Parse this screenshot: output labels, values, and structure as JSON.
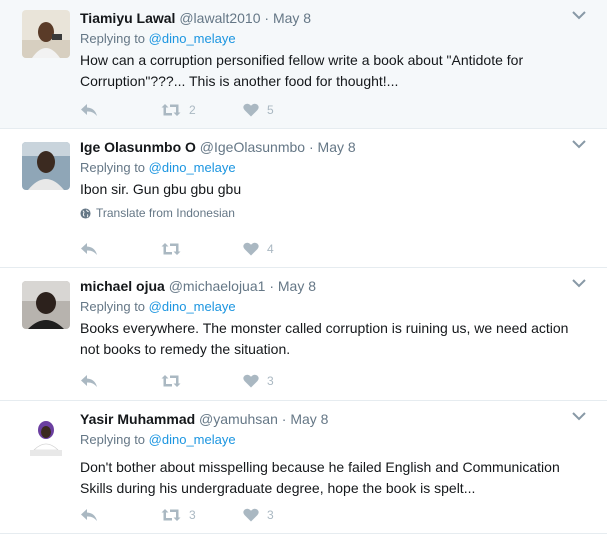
{
  "tweets": [
    {
      "name": "Tiamiyu Lawal",
      "handle": "@lawalt2010",
      "date": "May 8",
      "replying_prefix": "Replying to",
      "replying_to": "@dino_melaye",
      "text": "How can a corruption personified fellow write a book about \"Antidote for Corruption\"???... This is another food for thought!...",
      "translate": "",
      "retweets": "2",
      "likes": "5"
    },
    {
      "name": "Ige Olasunmbo O",
      "handle": "@IgeOlasunmbo",
      "date": "May 8",
      "replying_prefix": "Replying to",
      "replying_to": "@dino_melaye",
      "text": "Ibon sir.  Gun gbu gbu gbu",
      "translate": "Translate from Indonesian",
      "retweets": "",
      "likes": "4"
    },
    {
      "name": "michael ojua",
      "handle": "@michaelojua1",
      "date": "May 8",
      "replying_prefix": "Replying to",
      "replying_to": "@dino_melaye",
      "text": "Books everywhere. The monster called corruption is ruining us, we need action not books to remedy the situation.",
      "translate": "",
      "retweets": "",
      "likes": "3"
    },
    {
      "name": "Yasir Muhammad",
      "handle": "@yamuhsan",
      "date": "May 8",
      "replying_prefix": "Replying to",
      "replying_to": "@dino_melaye",
      "text": "Don't bother about misspelling because he failed English and Communication Skills during his undergraduate degree, hope the book is spelt...",
      "translate": "",
      "retweets": "3",
      "likes": "3"
    }
  ],
  "colors": {
    "link": "#1b95e0",
    "muted": "#657786",
    "action_icon": "#aab8c2",
    "highlight_bg": "#f5f8fa"
  },
  "icons": [
    "reply-icon",
    "retweet-icon",
    "like-icon",
    "globe-icon",
    "chevron-down-icon"
  ]
}
